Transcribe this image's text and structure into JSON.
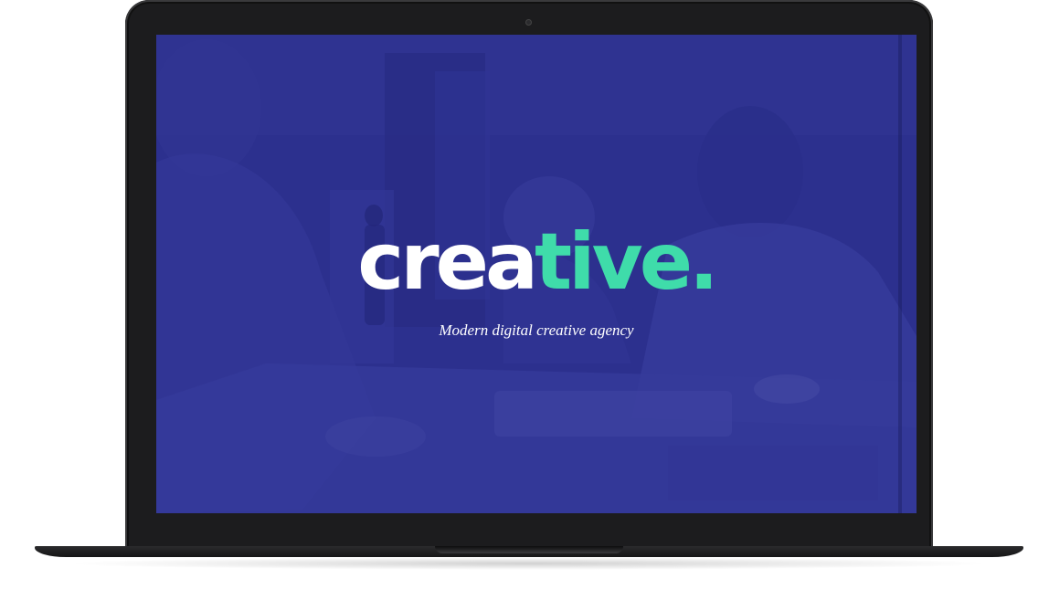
{
  "hero": {
    "headline_main": "crea",
    "headline_accent": "tive.",
    "tagline": "Modern digital creative agency"
  },
  "colors": {
    "screen_tint": "#2c3087",
    "accent": "#3fdcaa",
    "text": "#ffffff",
    "device_body": "#1c1c1e"
  },
  "icons": {
    "camera": "webcam-dot"
  }
}
